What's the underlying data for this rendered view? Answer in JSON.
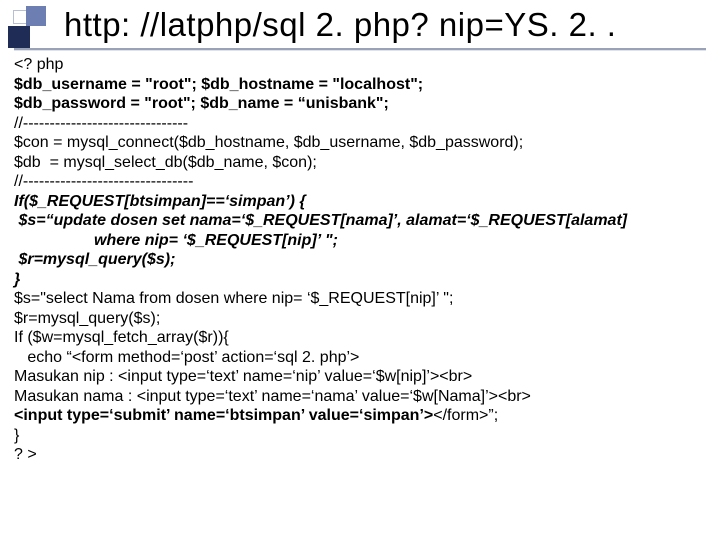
{
  "title": "http: //latphp/sql 2. php? nip=YS. 2. .",
  "code": {
    "l01": "<? php",
    "l02": "$db_username = \"root\"; $db_hostname = \"localhost\";",
    "l03a": "$db_password = ",
    "l03b": "\"root\"",
    "l03c": "; $db_name = “unisbank\";",
    "l04": "//-------------------------------",
    "l05": "$con = mysql_connect($db_hostname, $db_username, $db_password);",
    "l06": "$db  = mysql_select_db($db_name, $con);",
    "l07": "//--------------------------------",
    "l08": "If($_REQUEST[btsimpan]==‘simpan’) {",
    "l09": " $s=“update dosen set nama=‘$_REQUEST[nama]’, alamat=‘$_REQUEST[alamat]",
    "l10": "where nip= ‘$_REQUEST[nip]’ \";",
    "l11": " $r=mysql_query($s);",
    "l12": "}",
    "l13": "$s=\"select Nama from dosen where nip= ‘$_REQUEST[nip]’ \";",
    "l14": "$r=mysql_query($s);",
    "l15": "If ($w=mysql_fetch_array($r)){",
    "l16": "   echo “<form method=‘post’ action=‘sql 2. php’>",
    "l17": "Masukan nip : <input type=‘text’ name=‘nip’ value=‘$w[nip]’><br>",
    "l18": "Masukan nama : <input type=‘text’ name=‘nama’ value=‘$w[Nama]’><br>",
    "l19a": "<input type=‘submit’ name=‘btsimpan’ value=‘simpan’>",
    "l19b": "</form>”;",
    "l20": "}",
    "l21": "? >"
  }
}
